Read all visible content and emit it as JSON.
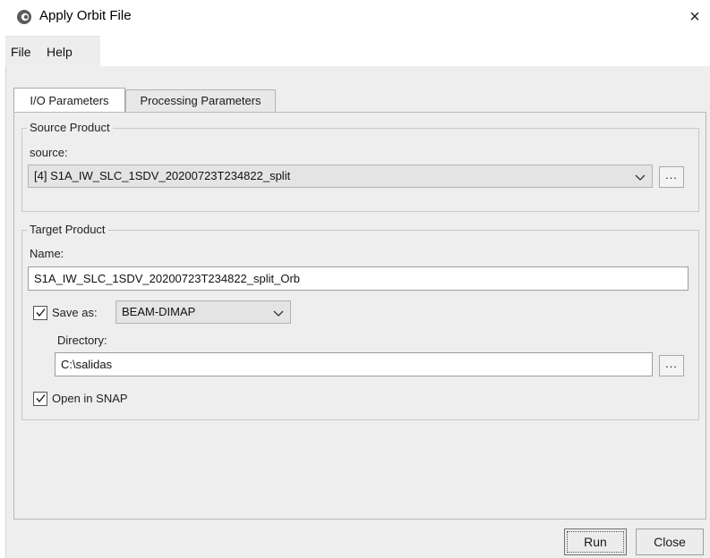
{
  "window": {
    "title": "Apply Orbit File",
    "close_glyph": "×",
    "icon": "snap-app-icon"
  },
  "menu": {
    "file": "File",
    "help": "Help"
  },
  "tabs": {
    "io": "I/O Parameters",
    "processing": "Processing Parameters"
  },
  "source": {
    "group_title": "Source Product",
    "label": "source:",
    "value": "[4] S1A_IW_SLC_1SDV_20200723T234822_split",
    "browse": "..."
  },
  "target": {
    "group_title": "Target Product",
    "name_label": "Name:",
    "name_value": "S1A_IW_SLC_1SDV_20200723T234822_split_Orb",
    "save_as_label": "Save as:",
    "save_as_checked": true,
    "format": "BEAM-DIMAP",
    "directory_label": "Directory:",
    "directory_value": "C:\\salidas",
    "browse": "...",
    "open_label": "Open in SNAP",
    "open_checked": true
  },
  "buttons": {
    "run": "Run",
    "close": "Close"
  }
}
